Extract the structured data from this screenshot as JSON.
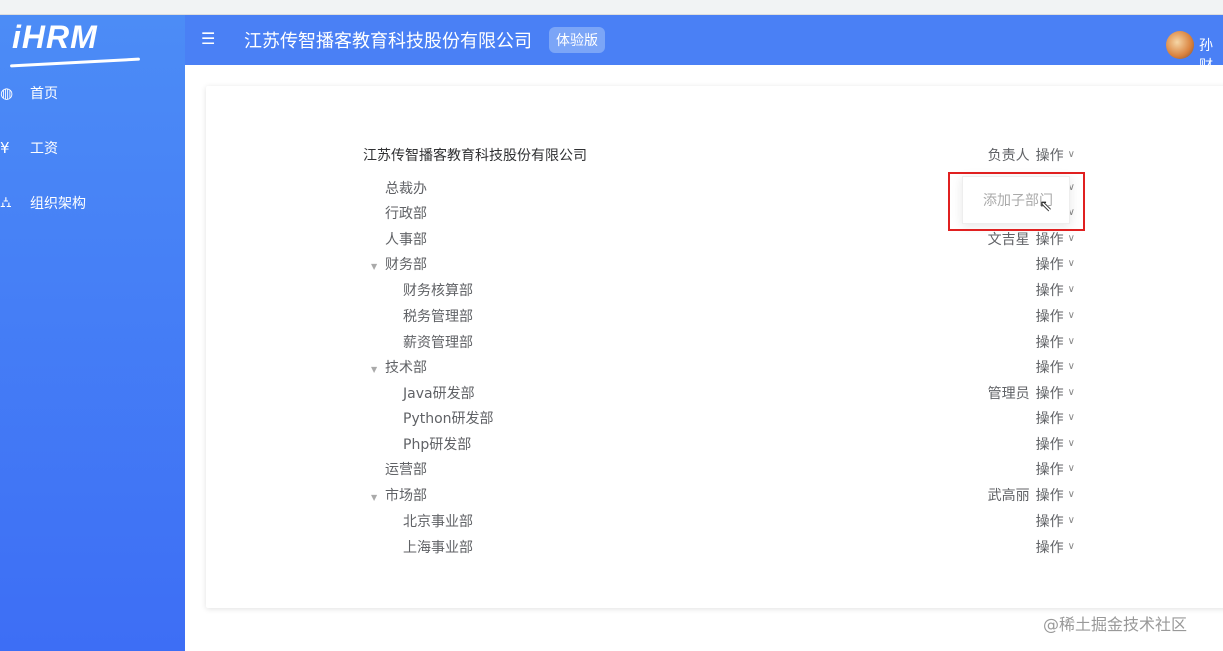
{
  "app": {
    "logo": "iHRM"
  },
  "sidebar": {
    "items": [
      {
        "icon": "dashboard-icon",
        "label": "首页"
      },
      {
        "icon": "yen-icon",
        "label": "工资"
      },
      {
        "icon": "org-chart-icon",
        "label": "组织架构"
      }
    ]
  },
  "header": {
    "company": "江苏传智播客教育科技股份有限公司",
    "badge": "体验版",
    "username": "孙财"
  },
  "tree": {
    "root": {
      "name": "江苏传智播客教育科技股份有限公司",
      "manager": "负责人",
      "action": "操作"
    },
    "rows": [
      {
        "name": "总裁办",
        "level": 1,
        "manager": "",
        "action": "操作",
        "expandable": false
      },
      {
        "name": "行政部",
        "level": 1,
        "manager": "",
        "action": "操作",
        "expandable": false
      },
      {
        "name": "人事部",
        "level": 1,
        "manager": "文吉星",
        "action": "操作",
        "expandable": false
      },
      {
        "name": "财务部",
        "level": 1,
        "manager": "",
        "action": "操作",
        "expandable": true
      },
      {
        "name": "财务核算部",
        "level": 2,
        "manager": "",
        "action": "操作",
        "expandable": false
      },
      {
        "name": "税务管理部",
        "level": 2,
        "manager": "",
        "action": "操作",
        "expandable": false
      },
      {
        "name": "薪资管理部",
        "level": 2,
        "manager": "",
        "action": "操作",
        "expandable": false
      },
      {
        "name": "技术部",
        "level": 1,
        "manager": "",
        "action": "操作",
        "expandable": true
      },
      {
        "name": "Java研发部",
        "level": 2,
        "manager": "管理员",
        "action": "操作",
        "expandable": false
      },
      {
        "name": "Python研发部",
        "level": 2,
        "manager": "",
        "action": "操作",
        "expandable": false
      },
      {
        "name": "Php研发部",
        "level": 2,
        "manager": "",
        "action": "操作",
        "expandable": false
      },
      {
        "name": "运营部",
        "level": 1,
        "manager": "",
        "action": "操作",
        "expandable": false
      },
      {
        "name": "市场部",
        "level": 1,
        "manager": "武高丽",
        "action": "操作",
        "expandable": true
      },
      {
        "name": "北京事业部",
        "level": 2,
        "manager": "",
        "action": "操作",
        "expandable": false
      },
      {
        "name": "上海事业部",
        "level": 2,
        "manager": "",
        "action": "操作",
        "expandable": false
      }
    ]
  },
  "dropdown": {
    "items": [
      "添加子部门"
    ]
  },
  "watermark": "@稀土掘金技术社区"
}
